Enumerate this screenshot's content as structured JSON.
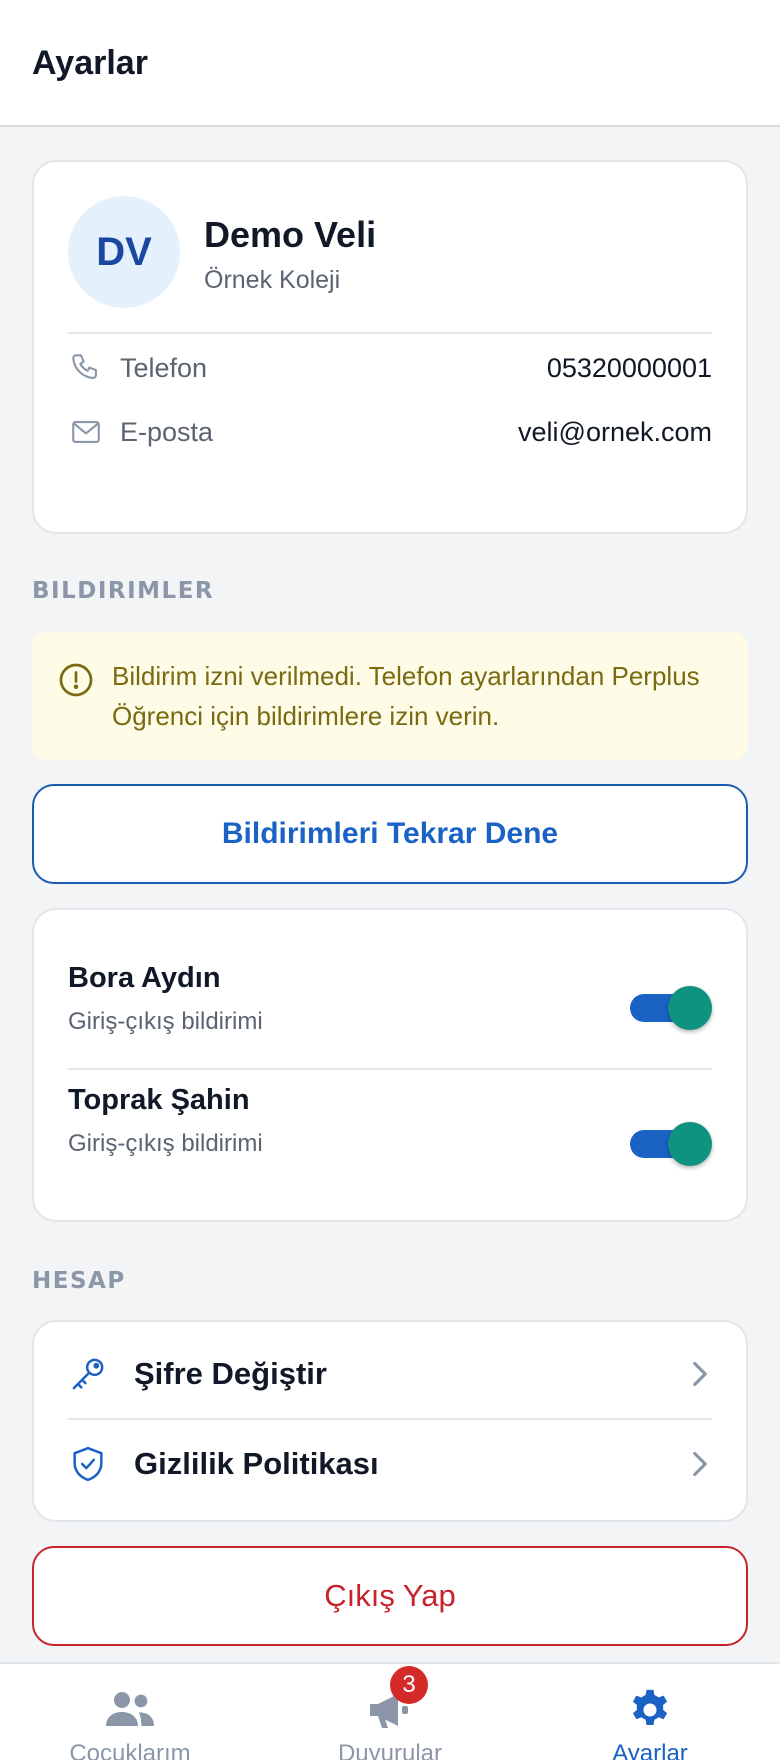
{
  "header": {
    "title": "Ayarlar"
  },
  "profile": {
    "initials": "DV",
    "name": "Demo Veli",
    "school": "Örnek Koleji",
    "phone_label": "Telefon",
    "phone_value": "05320000001",
    "email_label": "E-posta",
    "email_value": "veli@ornek.com"
  },
  "notifications": {
    "section_title": "BILDIRIMLER",
    "warning": "Bildirim izni verilmedi. Telefon ayarlarından Perplus Öğrenci için bildirimlere izin verin.",
    "retry_label": "Bildirimleri Tekrar Dene",
    "children": [
      {
        "name": "Bora Aydın",
        "subtitle": "Giriş-çıkış bildirimi",
        "enabled": true
      },
      {
        "name": "Toprak Şahin",
        "subtitle": "Giriş-çıkış bildirimi",
        "enabled": true
      }
    ]
  },
  "account": {
    "section_title": "HESAP",
    "items": [
      {
        "label": "Şifre Değiştir",
        "icon": "key-icon"
      },
      {
        "label": "Gizlilik Politikası",
        "icon": "shield-check-icon"
      }
    ]
  },
  "logout_label": "Çıkış Yap",
  "tabbar": {
    "tabs": [
      {
        "label": "Çocuklarım",
        "icon": "users-icon",
        "active": false
      },
      {
        "label": "Duyurular",
        "icon": "megaphone-icon",
        "active": false,
        "badge": "3"
      },
      {
        "label": "Ayarlar",
        "icon": "gear-icon",
        "active": true
      }
    ]
  },
  "colors": {
    "primary": "#1a62c4",
    "toggle_knob": "#0f9380",
    "danger": "#c8232c",
    "warning_bg": "#fefbe6",
    "warning_text": "#7a6a12",
    "badge": "#d42a2a"
  }
}
